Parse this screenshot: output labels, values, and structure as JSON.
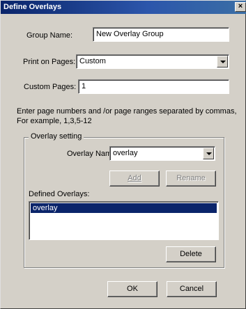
{
  "window": {
    "title": "Define Overlays",
    "close_label": "×"
  },
  "group_name": {
    "label": "Group Name:",
    "value": "New Overlay Group"
  },
  "print_on_pages": {
    "label": "Print on Pages:",
    "value": "Custom"
  },
  "custom_pages": {
    "label": "Custom Pages:",
    "value": "1"
  },
  "hint": {
    "line1": "Enter page numbers and /or page ranges separated by commas,",
    "line2": "For example, 1,3,5-12"
  },
  "overlay_setting": {
    "legend": "Overlay setting",
    "name_label": "Overlay Name",
    "name_value": "overlay",
    "add_label": "Add",
    "rename_label": "Rename",
    "defined_label": "Defined Overlays:",
    "defined_items": [
      "overlay"
    ],
    "delete_label": "Delete"
  },
  "footer": {
    "ok_label": "OK",
    "cancel_label": "Cancel"
  }
}
